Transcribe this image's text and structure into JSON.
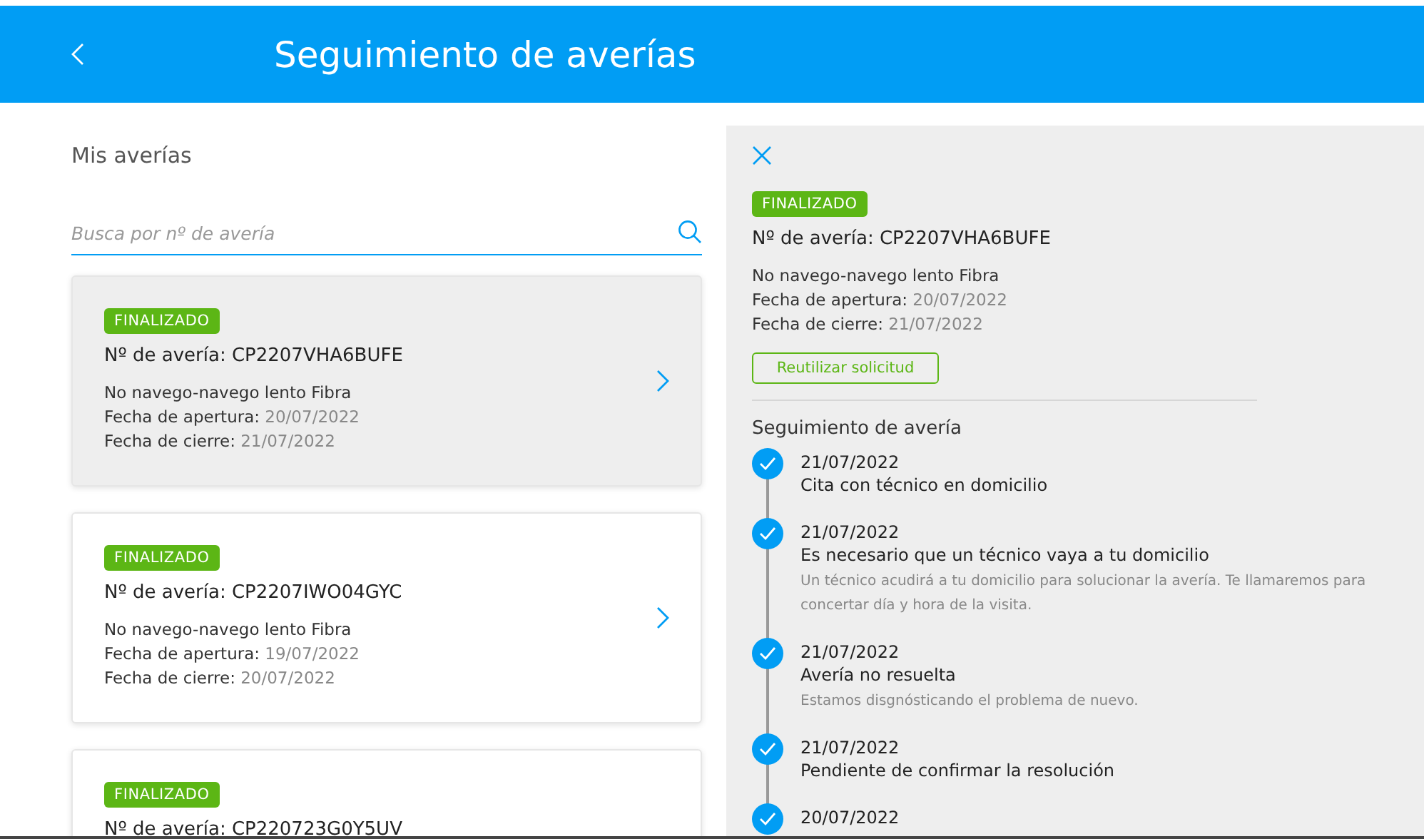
{
  "header": {
    "title": "Seguimiento de averías"
  },
  "list": {
    "title": "Mis averías",
    "search": {
      "placeholder": "Busca por nº de avería"
    },
    "cards": [
      {
        "status": "FINALIZADO",
        "number": "Nº de avería: CP2207VHA6BUFE",
        "description": "No navego-navego lento Fibra",
        "opened_label": "Fecha de apertura:",
        "opened": "20/07/2022",
        "closed_label": "Fecha de cierre:",
        "closed": "21/07/2022",
        "selected": true
      },
      {
        "status": "FINALIZADO",
        "number": "Nº de avería: CP2207IWO04GYC",
        "description": "No navego-navego lento Fibra",
        "opened_label": "Fecha de apertura:",
        "opened": "19/07/2022",
        "closed_label": "Fecha de cierre:",
        "closed": "20/07/2022",
        "selected": false
      },
      {
        "status": "FINALIZADO",
        "number": "Nº de avería: CP220723G0Y5UV",
        "selected": false
      }
    ]
  },
  "detail": {
    "status": "FINALIZADO",
    "number": "Nº de avería: CP2207VHA6BUFE",
    "description": "No navego-navego lento Fibra",
    "opened_label": "Fecha de apertura:",
    "opened": "20/07/2022",
    "closed_label": "Fecha de cierre:",
    "closed": "21/07/2022",
    "reuse_button": "Reutilizar solicitud",
    "tracking_title": "Seguimiento de avería",
    "steps": [
      {
        "date": "21/07/2022",
        "title": "Cita con técnico en domicilio",
        "done": true
      },
      {
        "date": "21/07/2022",
        "title": "Es necesario que un técnico vaya a tu domicilio",
        "note": "Un técnico acudirá a tu domicilio para solucionar la avería. Te llamaremos para concertar día y hora de la visita.",
        "done": true
      },
      {
        "date": "21/07/2022",
        "title": "Avería no resuelta",
        "note": "Estamos disgnósticando el problema de nuevo.",
        "done": true
      },
      {
        "date": "21/07/2022",
        "title": "Pendiente de confirmar la resolución",
        "done": true
      },
      {
        "date": "20/07/2022",
        "done": true
      }
    ]
  }
}
